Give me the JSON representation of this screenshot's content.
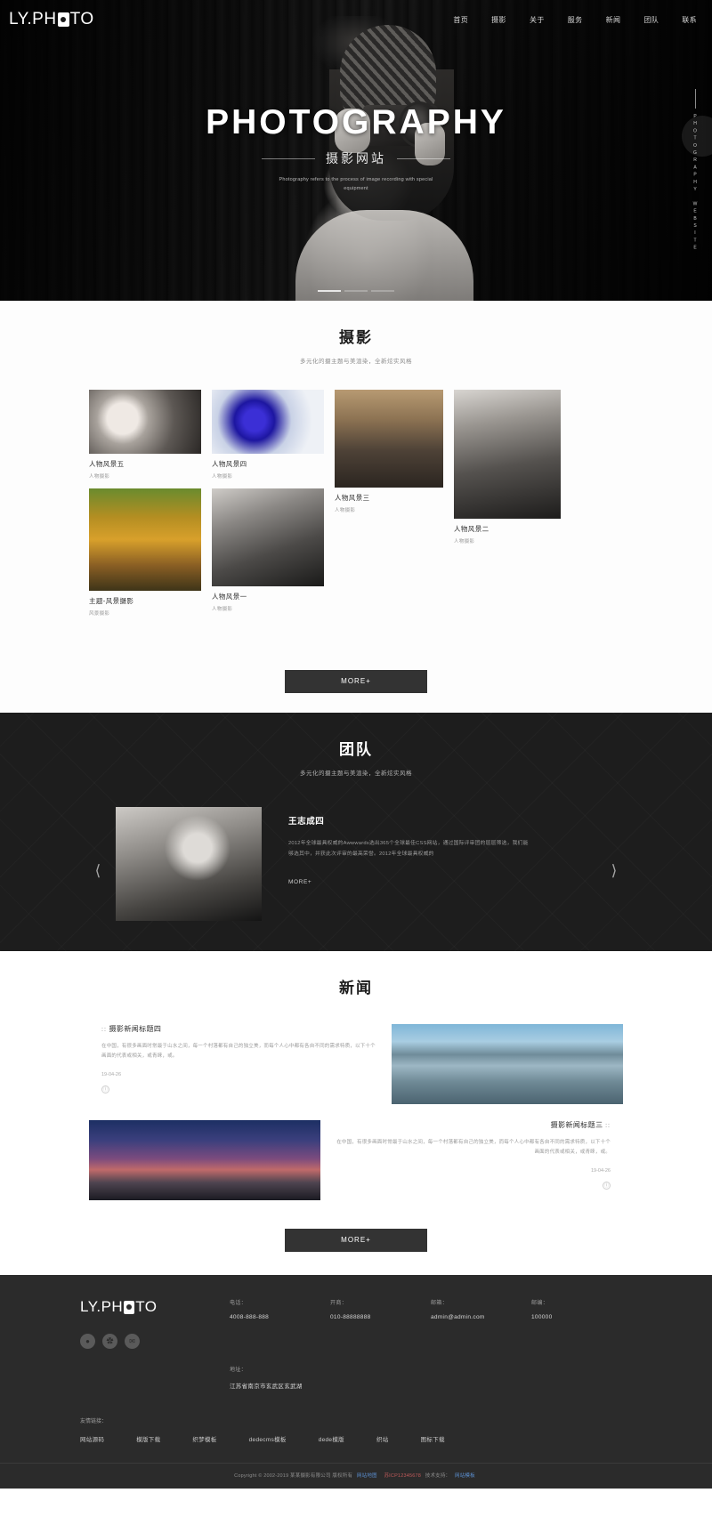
{
  "header": {
    "logo_pre": "LY.PH",
    "logo_post": "TO",
    "nav": [
      {
        "label": "首页"
      },
      {
        "label": "摄影"
      },
      {
        "label": "关于"
      },
      {
        "label": "服务"
      },
      {
        "label": "新闻"
      },
      {
        "label": "团队"
      },
      {
        "label": "联系"
      }
    ]
  },
  "hero": {
    "title": "PHOTOGRAPHY",
    "subtitle": "摄影网站",
    "description": "Photography refers to the process of image recording with special equipment",
    "vertical_text": "PHOTOGRAPHY WEBSITE"
  },
  "photography": {
    "title": "摄影",
    "subtitle": "多元化的摄主题与美渲染，全新炫实风格",
    "items": [
      {
        "name": "人物风景五",
        "category": "人物摄影"
      },
      {
        "name": "人物风景四",
        "category": "人物摄影"
      },
      {
        "name": "人物风景三",
        "category": "人物摄影"
      },
      {
        "name": "人物风景二",
        "category": "人物摄影"
      },
      {
        "name": "主题-风景摄影",
        "category": "风景摄影"
      },
      {
        "name": "人物风景一",
        "category": "人物摄影"
      }
    ],
    "more_label": "MORE+"
  },
  "team": {
    "title": "团队",
    "subtitle": "多元化的摄主题与美渲染，全新炫实风格",
    "member_name": "王志成四",
    "member_desc": "2012年全球最具权威的Awwwards选出365个全球最佳CSS网站，通过国际评审团的层层筛选，我们能够选其中，并获此次评审的最高荣誉。2012年全球最具权威的",
    "more_label": "MORE+",
    "prev_icon": "chevron-left",
    "next_icon": "chevron-right"
  },
  "news": {
    "title": "新闻",
    "items": [
      {
        "bullets": "::",
        "title": "摄影新闻标题四",
        "desc": "在中国，有很多画面时常最于山水之间，每一个村落都有自己的独立美，而每个人心中都有各自不同的需求特质，以下十个画面的代表或相关，或青睐，或。",
        "date": "19-04-26",
        "badge": "①"
      },
      {
        "bullets": "::",
        "title": "摄影新闻标题三",
        "desc": "在中国，有很多画面时常最于山水之间，每一个村落都有自己的独立美，而每个人心中都有各自不同的需求特质，以下十个画面的代表或相关，或青睐，或。",
        "date": "19-04-26",
        "badge": "①"
      }
    ],
    "more_label": "MORE+"
  },
  "footer": {
    "logo_pre": "LY.PH",
    "logo_post": "TO",
    "socials": [
      "qq-icon",
      "weibo-icon",
      "wechat-icon"
    ],
    "contacts": [
      {
        "label": "电话：",
        "value": "4008-888-888"
      },
      {
        "label": "开商：",
        "value": "010-88888888"
      },
      {
        "label": "邮箱：",
        "value": "admin@admin.com"
      },
      {
        "label": "邮编：",
        "value": "100000"
      }
    ],
    "address": {
      "label": "地址：",
      "value": "江苏省南京市玄武区玄武湖"
    },
    "links_label": "友情链接：",
    "links": [
      {
        "label": "网站源码"
      },
      {
        "label": "模版下载"
      },
      {
        "label": "织梦模板"
      },
      {
        "label": "dedecms模板"
      },
      {
        "label": "dede模版"
      },
      {
        "label": "织站"
      },
      {
        "label": "图标下载"
      }
    ],
    "copyright": "Copyright © 2002-2019 某某摄影有限公司 版权所有",
    "copy_links": [
      {
        "label": "网站地图",
        "color": "blue"
      },
      {
        "label": "苏ICP12345678",
        "color": "red"
      },
      {
        "label": "技术支持：",
        "color": "plain"
      },
      {
        "label": "网站模板",
        "color": "blue"
      }
    ]
  }
}
